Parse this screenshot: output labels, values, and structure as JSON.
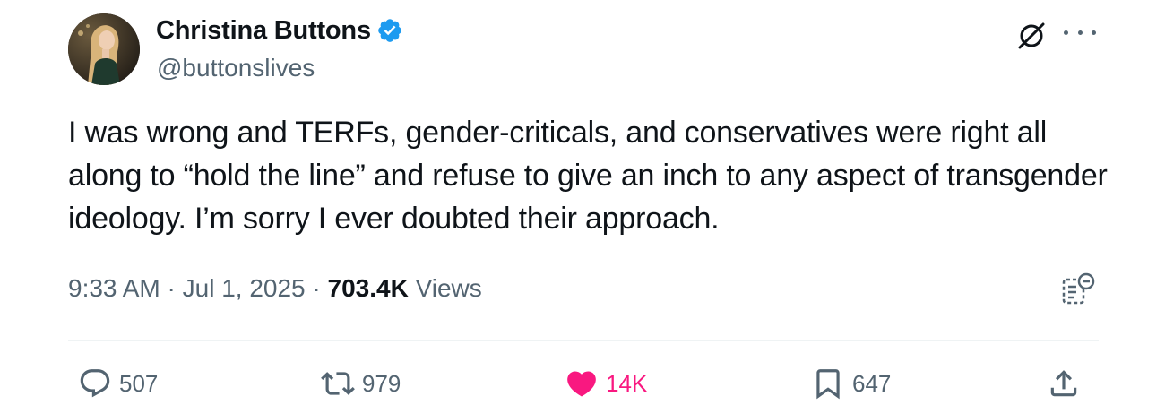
{
  "tweet": {
    "author": {
      "display_name": "Christina Buttons",
      "handle": "@buttonslives",
      "verified": true,
      "verified_color": "#1d9bf0"
    },
    "text": "I was wrong and TERFs, gender-criticals, and conservatives were right all along to “hold the line” and refuse to give an inch to any aspect of transgender ideology. I’m sorry I ever doubted their approach.",
    "meta": {
      "time": "9:33 AM",
      "separator": "·",
      "date": "Jul 1, 2025",
      "views_count": "703.4K",
      "views_label": "Views"
    },
    "icons": {
      "top_right": [
        "grok-icon",
        "more-icon"
      ],
      "analytics": "analytics-icon"
    },
    "actions": {
      "reply": {
        "icon": "reply-icon",
        "count": "507"
      },
      "retweet": {
        "icon": "retweet-icon",
        "count": "979"
      },
      "like": {
        "icon": "heart-icon",
        "count": "14K",
        "liked": true,
        "color": "#f91880"
      },
      "bookmark": {
        "icon": "bookmark-icon",
        "count": "647"
      },
      "share": {
        "icon": "share-icon"
      }
    }
  }
}
